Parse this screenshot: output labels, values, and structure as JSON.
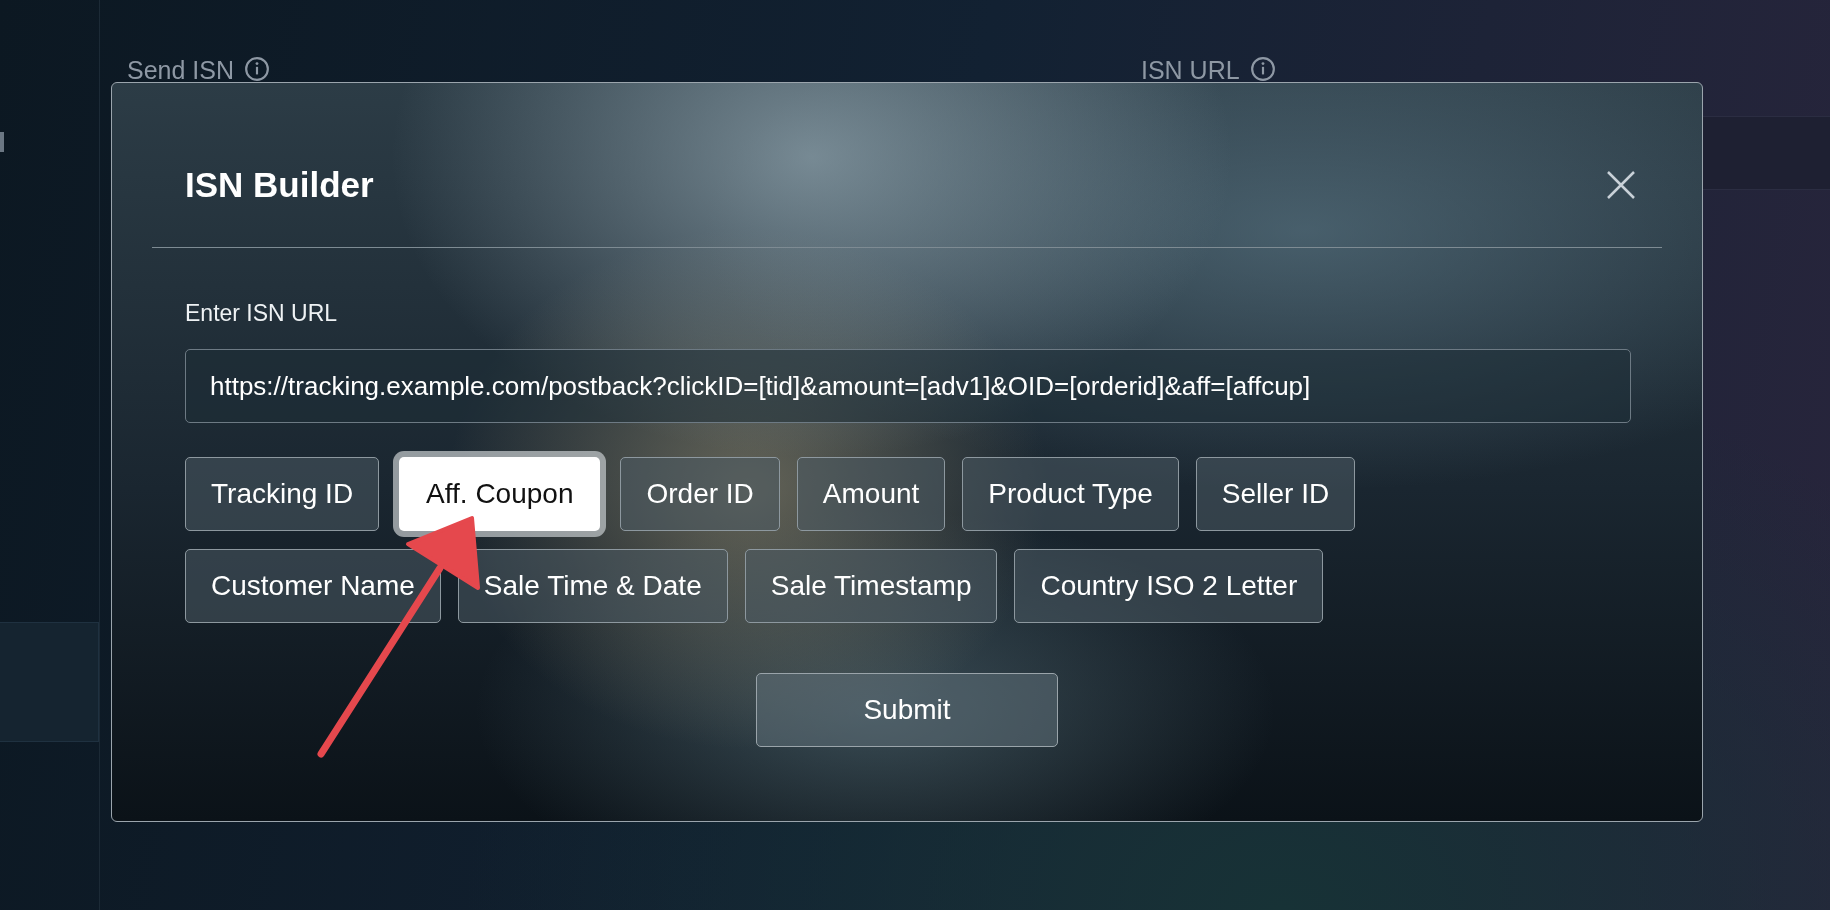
{
  "background": {
    "fields": [
      {
        "label": "Send ISN"
      },
      {
        "label": "ISN URL"
      }
    ]
  },
  "dialog": {
    "title": "ISN Builder",
    "url_label": "Enter ISN URL",
    "url_value": "https://tracking.example.com/postback?clickID=[tid]&amount=[adv1]&OID=[orderid]&aff=[affcup]",
    "token_rows": [
      [
        {
          "label": "Tracking ID",
          "selected": false
        },
        {
          "label": "Aff. Coupon",
          "selected": true
        },
        {
          "label": "Order ID",
          "selected": false
        },
        {
          "label": "Amount",
          "selected": false
        },
        {
          "label": "Product Type",
          "selected": false
        },
        {
          "label": "Seller ID",
          "selected": false
        }
      ],
      [
        {
          "label": "Customer Name",
          "selected": false
        },
        {
          "label": "Sale Time & Date",
          "selected": false
        },
        {
          "label": "Sale Timestamp",
          "selected": false
        },
        {
          "label": "Country ISO 2 Letter",
          "selected": false
        }
      ]
    ],
    "submit": "Submit"
  }
}
